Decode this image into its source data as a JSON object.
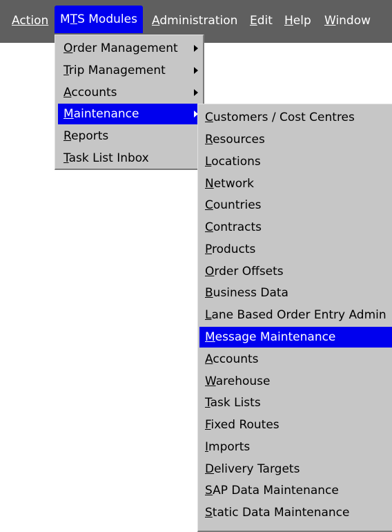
{
  "menubar": {
    "items": [
      {
        "label": "Action"
      },
      {
        "label": "MTS Modules",
        "active": true
      },
      {
        "label": "Administration"
      },
      {
        "label": "Edit"
      },
      {
        "label": "Help"
      },
      {
        "label": "Window"
      }
    ]
  },
  "mts_menu": {
    "items": [
      {
        "label": "Order Management",
        "submenu": true
      },
      {
        "label": "Trip Management",
        "submenu": true
      },
      {
        "label": "Accounts",
        "submenu": true
      },
      {
        "label": "Maintenance",
        "submenu": true,
        "highlighted": true
      },
      {
        "label": "Reports"
      },
      {
        "label": "Task List Inbox"
      }
    ]
  },
  "maintenance_menu": {
    "items": [
      {
        "label": "Customers / Cost Centres"
      },
      {
        "label": "Resources"
      },
      {
        "label": "Locations"
      },
      {
        "label": "Network"
      },
      {
        "label": "Countries"
      },
      {
        "label": "Contracts"
      },
      {
        "label": "Products"
      },
      {
        "label": "Order Offsets"
      },
      {
        "label": "Business Data"
      },
      {
        "label": "Lane Based Order Entry Admin"
      },
      {
        "label": "Message Maintenance",
        "highlighted": true
      },
      {
        "label": "Accounts"
      },
      {
        "label": "Warehouse"
      },
      {
        "label": "Task Lists"
      },
      {
        "label": "Fixed Routes"
      },
      {
        "label": "Imports"
      },
      {
        "label": "Delivery Targets"
      },
      {
        "label": "SAP Data Maintenance"
      },
      {
        "label": "Static Data Maintenance"
      }
    ]
  },
  "colors": {
    "menubar_bg": "#5f5f5f",
    "menu_bg": "#c6c6c6",
    "highlight": "#0000ee"
  }
}
